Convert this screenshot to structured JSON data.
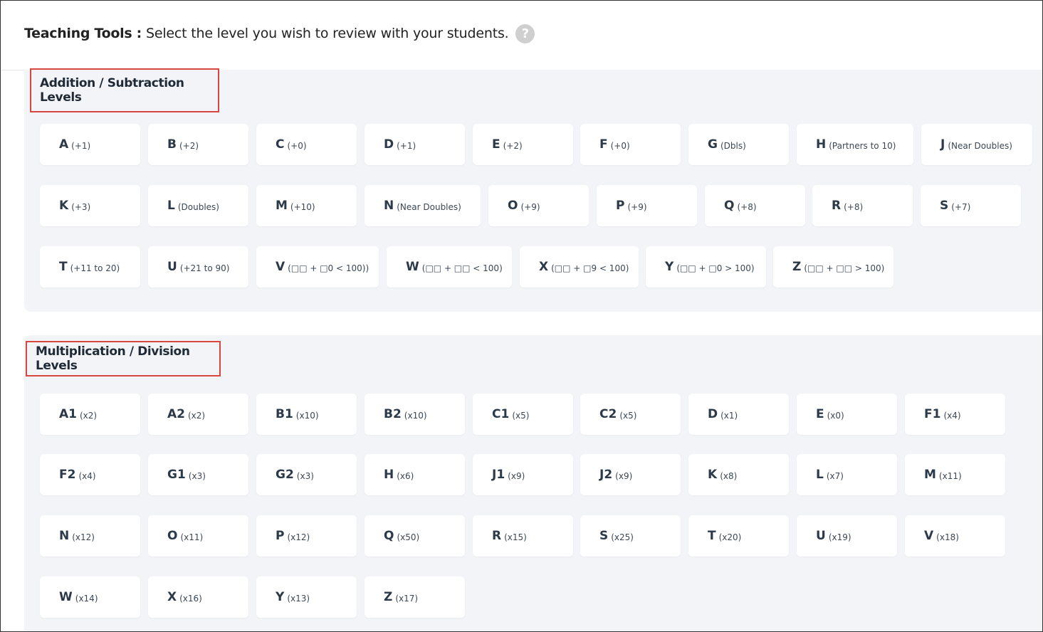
{
  "header": {
    "title": "Teaching Tools :",
    "description": "Select the level you wish to review with your students.",
    "help_symbol": "?"
  },
  "addition": {
    "title": "Addition / Subtraction Levels",
    "levels": [
      {
        "letter": "A",
        "hint": "(+1)"
      },
      {
        "letter": "B",
        "hint": "(+2)"
      },
      {
        "letter": "C",
        "hint": "(+0)"
      },
      {
        "letter": "D",
        "hint": "(+1)"
      },
      {
        "letter": "E",
        "hint": "(+2)"
      },
      {
        "letter": "F",
        "hint": "(+0)"
      },
      {
        "letter": "G",
        "hint": "(Dbls)"
      },
      {
        "letter": "H",
        "hint": "(Partners to 10)"
      },
      {
        "letter": "J",
        "hint": "(Near Doubles)"
      },
      {
        "letter": "K",
        "hint": "(+3)"
      },
      {
        "letter": "L",
        "hint": "(Doubles)"
      },
      {
        "letter": "M",
        "hint": "(+10)"
      },
      {
        "letter": "N",
        "hint": "(Near Doubles)"
      },
      {
        "letter": "O",
        "hint": "(+9)"
      },
      {
        "letter": "P",
        "hint": "(+9)"
      },
      {
        "letter": "Q",
        "hint": "(+8)"
      },
      {
        "letter": "R",
        "hint": "(+8)"
      },
      {
        "letter": "S",
        "hint": "(+7)"
      },
      {
        "letter": "T",
        "hint": "(+11 to 20)"
      },
      {
        "letter": "U",
        "hint": "(+21 to 90)"
      },
      {
        "letter": "V",
        "hint": "(□□ + □0 < 100))"
      },
      {
        "letter": "W",
        "hint": "(□□ + □□ < 100)"
      },
      {
        "letter": "X",
        "hint": "(□□ + □9 < 100)"
      },
      {
        "letter": "Y",
        "hint": "(□□ + □0 > 100)"
      },
      {
        "letter": "Z",
        "hint": "(□□ + □□ > 100)"
      }
    ]
  },
  "multiplication": {
    "title": "Multiplication / Division Levels",
    "levels": [
      {
        "letter": "A1",
        "hint": "(x2)"
      },
      {
        "letter": "A2",
        "hint": "(x2)"
      },
      {
        "letter": "B1",
        "hint": "(x10)"
      },
      {
        "letter": "B2",
        "hint": "(x10)"
      },
      {
        "letter": "C1",
        "hint": "(x5)"
      },
      {
        "letter": "C2",
        "hint": "(x5)"
      },
      {
        "letter": "D",
        "hint": "(x1)"
      },
      {
        "letter": "E",
        "hint": "(x0)"
      },
      {
        "letter": "F1",
        "hint": "(x4)"
      },
      {
        "letter": "F2",
        "hint": "(x4)"
      },
      {
        "letter": "G1",
        "hint": "(x3)"
      },
      {
        "letter": "G2",
        "hint": "(x3)"
      },
      {
        "letter": "H",
        "hint": "(x6)"
      },
      {
        "letter": "J1",
        "hint": "(x9)"
      },
      {
        "letter": "J2",
        "hint": "(x9)"
      },
      {
        "letter": "K",
        "hint": "(x8)"
      },
      {
        "letter": "L",
        "hint": "(x7)"
      },
      {
        "letter": "M",
        "hint": "(x11)"
      },
      {
        "letter": "N",
        "hint": "(x12)"
      },
      {
        "letter": "O",
        "hint": "(x11)"
      },
      {
        "letter": "P",
        "hint": "(x12)"
      },
      {
        "letter": "Q",
        "hint": "(x50)"
      },
      {
        "letter": "R",
        "hint": "(x15)"
      },
      {
        "letter": "S",
        "hint": "(x25)"
      },
      {
        "letter": "T",
        "hint": "(x20)"
      },
      {
        "letter": "U",
        "hint": "(x19)"
      },
      {
        "letter": "V",
        "hint": "(x18)"
      },
      {
        "letter": "W",
        "hint": "(x14)"
      },
      {
        "letter": "X",
        "hint": "(x16)"
      },
      {
        "letter": "Y",
        "hint": "(x13)"
      },
      {
        "letter": "Z",
        "hint": "(x17)"
      }
    ]
  }
}
